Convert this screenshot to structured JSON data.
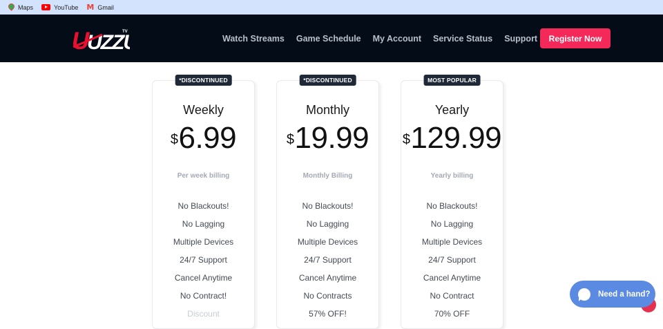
{
  "bookmarks": [
    {
      "label": "Maps",
      "icon": "maps-icon"
    },
    {
      "label": "YouTube",
      "icon": "youtube-icon"
    },
    {
      "label": "Gmail",
      "icon": "gmail-icon"
    }
  ],
  "brand": {
    "logo_text": "UZZU",
    "logo_suffix": "TV",
    "accent": "#f5285a",
    "nav_bg": "#040c18"
  },
  "nav": {
    "links": [
      "Watch Streams",
      "Game Schedule",
      "My Account",
      "Service Status",
      "Support"
    ],
    "register_label": "Register Now"
  },
  "plans": [
    {
      "badge": "*DISCONTINUED",
      "name": "Weekly",
      "currency": "$",
      "price": "6.99",
      "billing": "Per week billing",
      "features": [
        "No Blackouts!",
        "No Lagging",
        "Multiple Devices",
        "24/7 Support",
        "Cancel Anytime",
        "No Contract!",
        "Discount"
      ]
    },
    {
      "badge": "*DISCONTINUED",
      "name": "Monthly",
      "currency": "$",
      "price": "19.99",
      "billing": "Monthly Billing",
      "features": [
        "No Blackouts!",
        "No Lagging",
        "Multiple Devices",
        "24/7 Support",
        "Cancel Anytime",
        "No Contracts",
        "57% OFF!"
      ]
    },
    {
      "badge": "MOST POPULAR",
      "name": "Yearly",
      "currency": "$",
      "price": "129.99",
      "billing": "Yearly billing",
      "features": [
        "No Blackouts!",
        "No Lagging",
        "Multiple Devices",
        "24/7 Support",
        "Cancel Anytime",
        "No Contract",
        "70% OFF"
      ]
    }
  ],
  "chat": {
    "label": "Need a hand?",
    "color": "#5b8ae3"
  }
}
